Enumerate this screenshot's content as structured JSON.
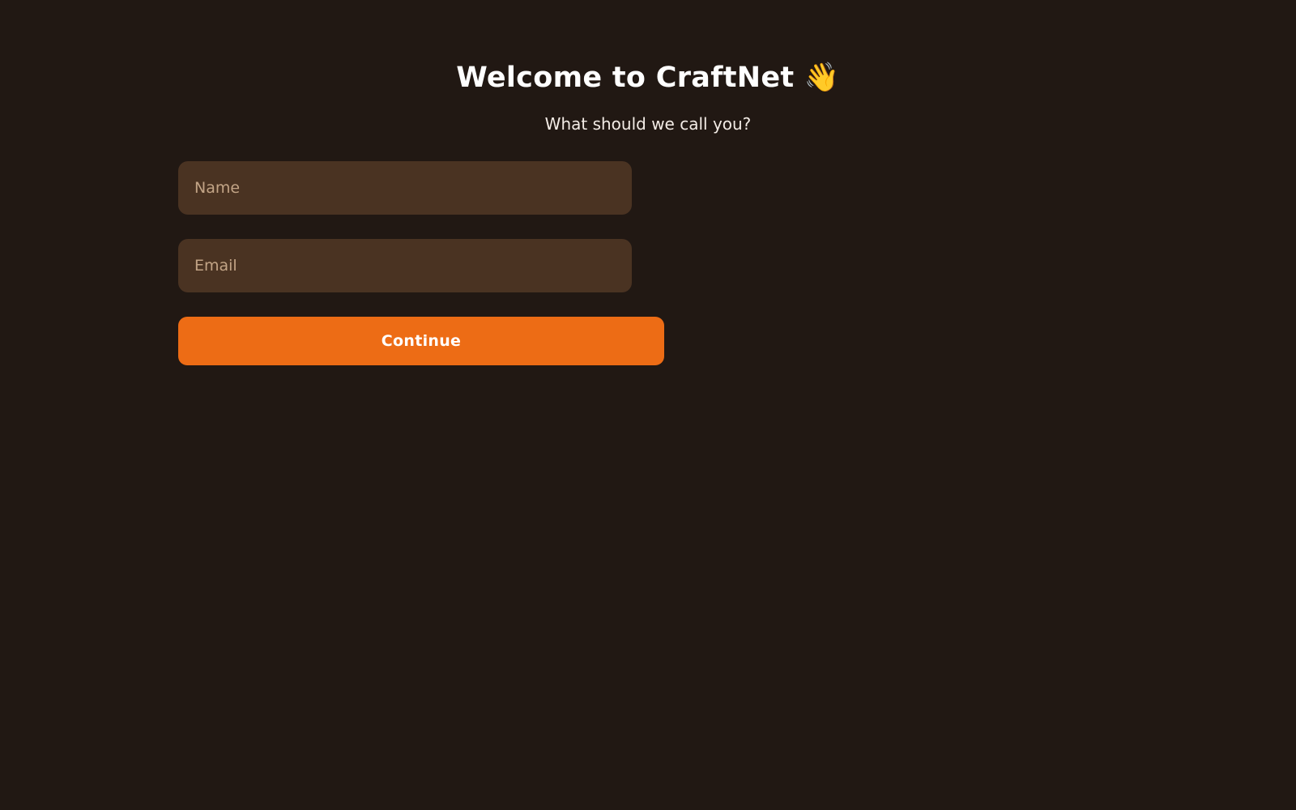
{
  "header": {
    "title": "Welcome to CraftNet",
    "title_emoji": "👋",
    "title_emoji_icon": "waving-hand-icon",
    "subtitle": "What should we call you?"
  },
  "form": {
    "name_field": {
      "value": "",
      "placeholder": "Name"
    },
    "email_field": {
      "value": "",
      "placeholder": "Email"
    },
    "continue_label": "Continue"
  },
  "colors": {
    "background": "#211813",
    "input_background": "#4a3322",
    "placeholder": "#c2a486",
    "accent": "#ed6c15",
    "text": "#ffffff"
  }
}
